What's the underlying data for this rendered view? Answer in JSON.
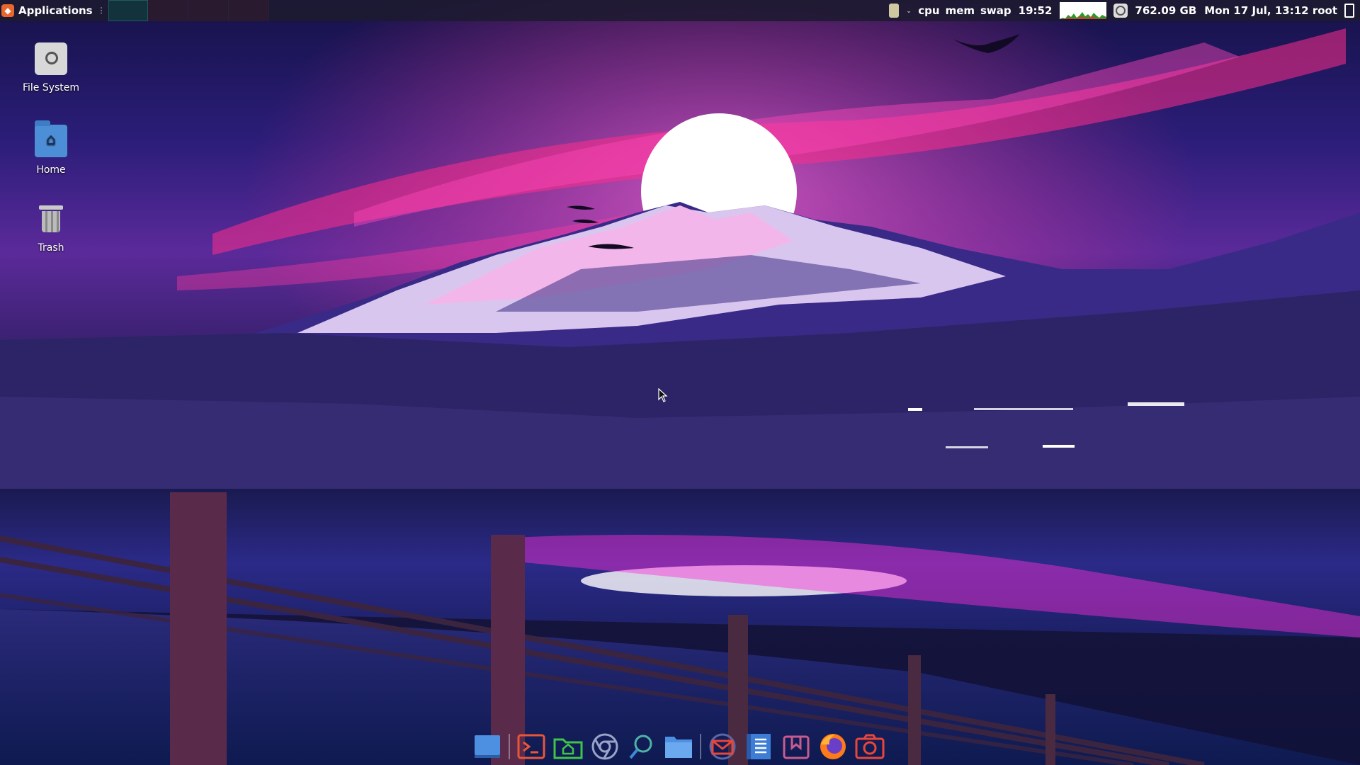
{
  "panel": {
    "apps_label": "Applications",
    "workspaces": [
      "",
      "",
      "",
      ""
    ],
    "active_workspace": 0,
    "cpu_label": "cpu",
    "mem_label": "mem",
    "swap_label": "swap",
    "uptime": "19:52",
    "disk_free": "762.09 GB",
    "clock": "Mon 17 Jul, 13:12",
    "user": "root"
  },
  "desktop_icons": [
    {
      "label": "File System",
      "icon": "drive-icon"
    },
    {
      "label": "Home",
      "icon": "home-folder-icon"
    },
    {
      "label": "Trash",
      "icon": "trash-icon"
    }
  ],
  "dock": [
    {
      "name": "show-desktop",
      "icon": "desktop-icon"
    },
    {
      "name": "terminal",
      "icon": "terminal-icon"
    },
    {
      "name": "home-folder",
      "icon": "home-folder-icon"
    },
    {
      "name": "chromium",
      "icon": "browser-icon"
    },
    {
      "name": "search",
      "icon": "search-icon"
    },
    {
      "name": "files",
      "icon": "folder-icon"
    },
    {
      "name": "mail",
      "icon": "mail-icon"
    },
    {
      "name": "text-editor",
      "icon": "document-icon"
    },
    {
      "name": "bookmarks",
      "icon": "bookmark-icon"
    },
    {
      "name": "firefox",
      "icon": "firefox-icon"
    },
    {
      "name": "screenshot",
      "icon": "camera-icon"
    }
  ],
  "colors": {
    "panel_bg": "#1c1a30",
    "accent": "#e9662c",
    "monitor_green": "#3ccc3c",
    "sky_top": "#1a1650",
    "sky_glow": "#ff2e8a",
    "sun": "#ffffff"
  }
}
